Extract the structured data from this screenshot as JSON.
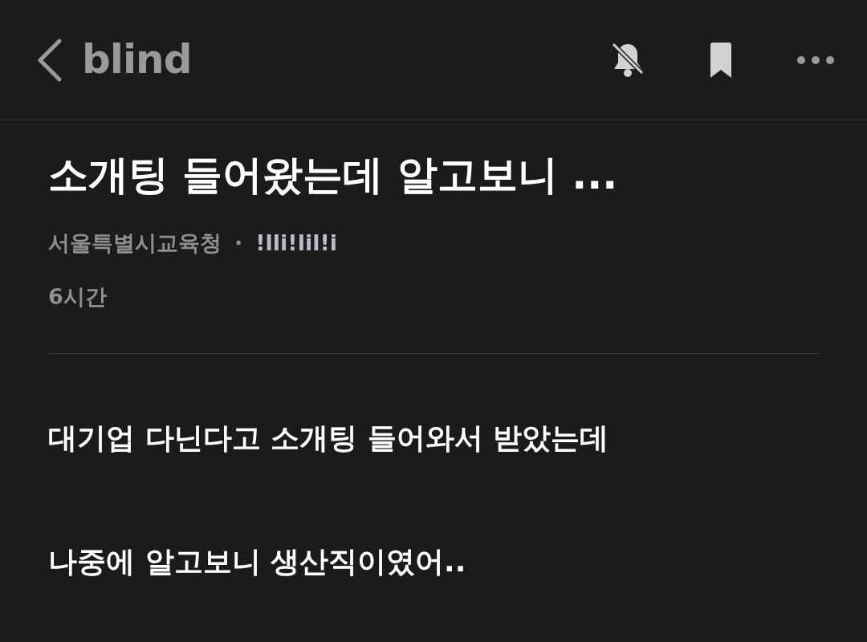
{
  "header": {
    "logo": "blind"
  },
  "post": {
    "title": "소개팅 들어왔는데 알고보니 ...",
    "company": "서울특별시교육청",
    "separator": "·",
    "author": "!lli!lil!i",
    "time": "6시간",
    "paragraphs": [
      "대기업 다닌다고 소개팅 들어와서 받았는데",
      "나중에 알고보니 생산직이였어.."
    ]
  }
}
